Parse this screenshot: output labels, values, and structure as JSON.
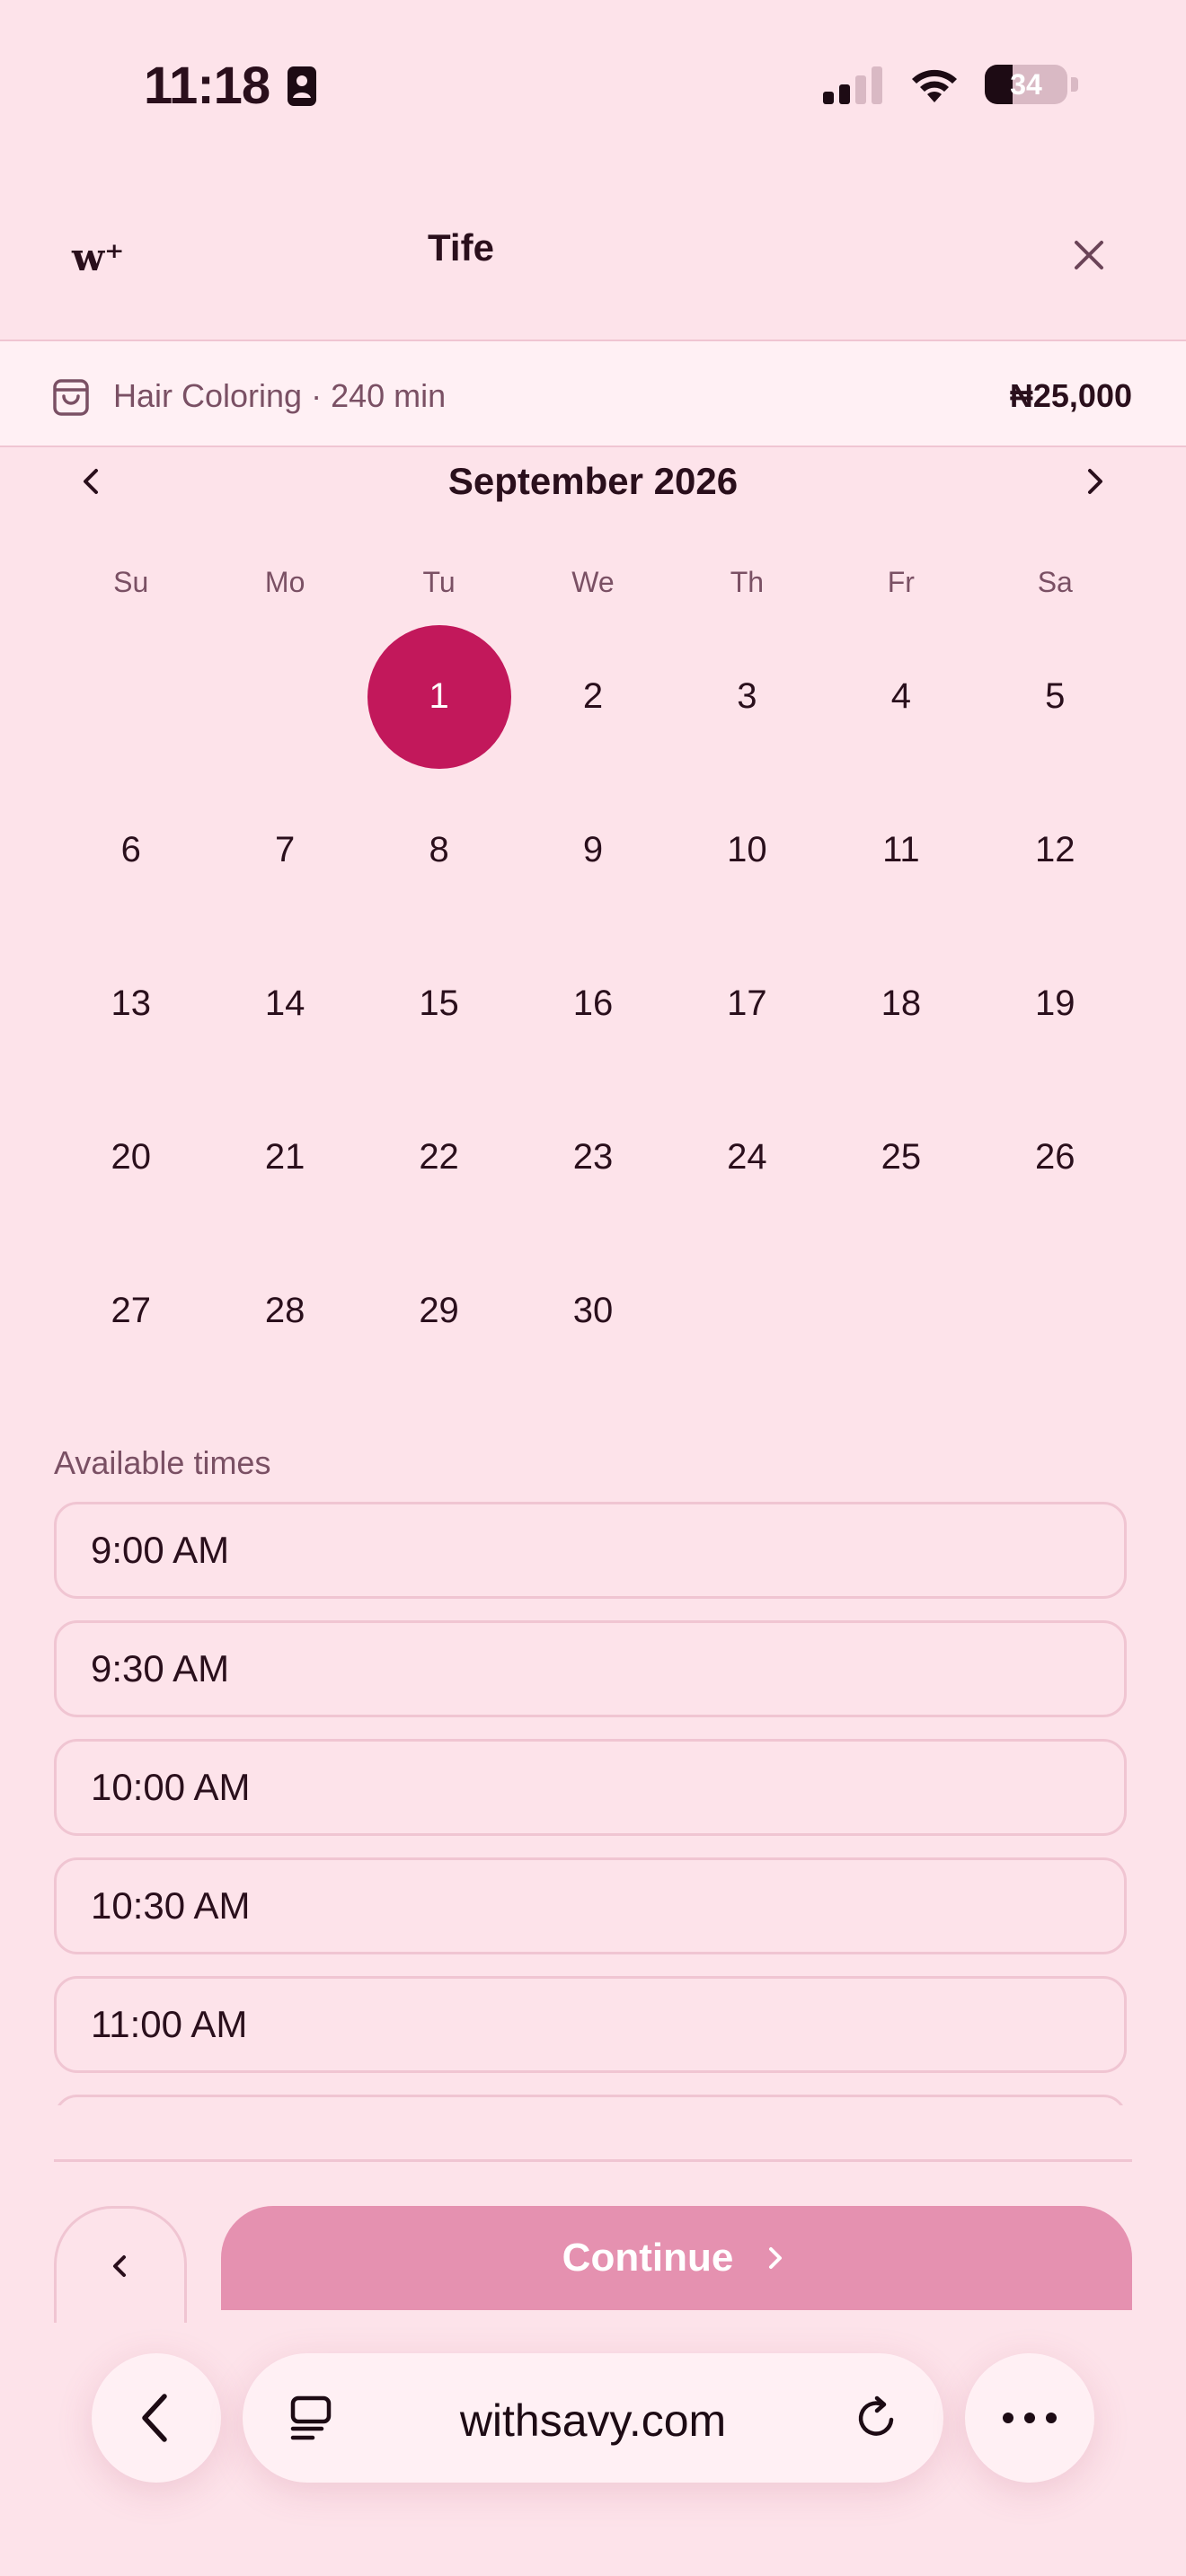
{
  "status_bar": {
    "time": "11:18",
    "battery": "34"
  },
  "header": {
    "logo": "w⁺",
    "title": "Tife"
  },
  "service": {
    "label": "Hair Coloring · 240 min",
    "price": "₦25,000"
  },
  "calendar": {
    "month": "September 2026",
    "weekdays": [
      "Su",
      "Mo",
      "Tu",
      "We",
      "Th",
      "Fr",
      "Sa"
    ],
    "leading_blanks": 2,
    "days": [
      "1",
      "2",
      "3",
      "4",
      "5",
      "6",
      "7",
      "8",
      "9",
      "10",
      "11",
      "12",
      "13",
      "14",
      "15",
      "16",
      "17",
      "18",
      "19",
      "20",
      "21",
      "22",
      "23",
      "24",
      "25",
      "26",
      "27",
      "28",
      "29",
      "30"
    ],
    "selected_day": "1"
  },
  "times": {
    "label": "Available times",
    "slots": [
      "9:00 AM",
      "9:30 AM",
      "10:00 AM",
      "10:30 AM",
      "11:00 AM",
      ""
    ]
  },
  "footer": {
    "continue_label": "Continue"
  },
  "browser": {
    "url": "withsavy.com"
  }
}
